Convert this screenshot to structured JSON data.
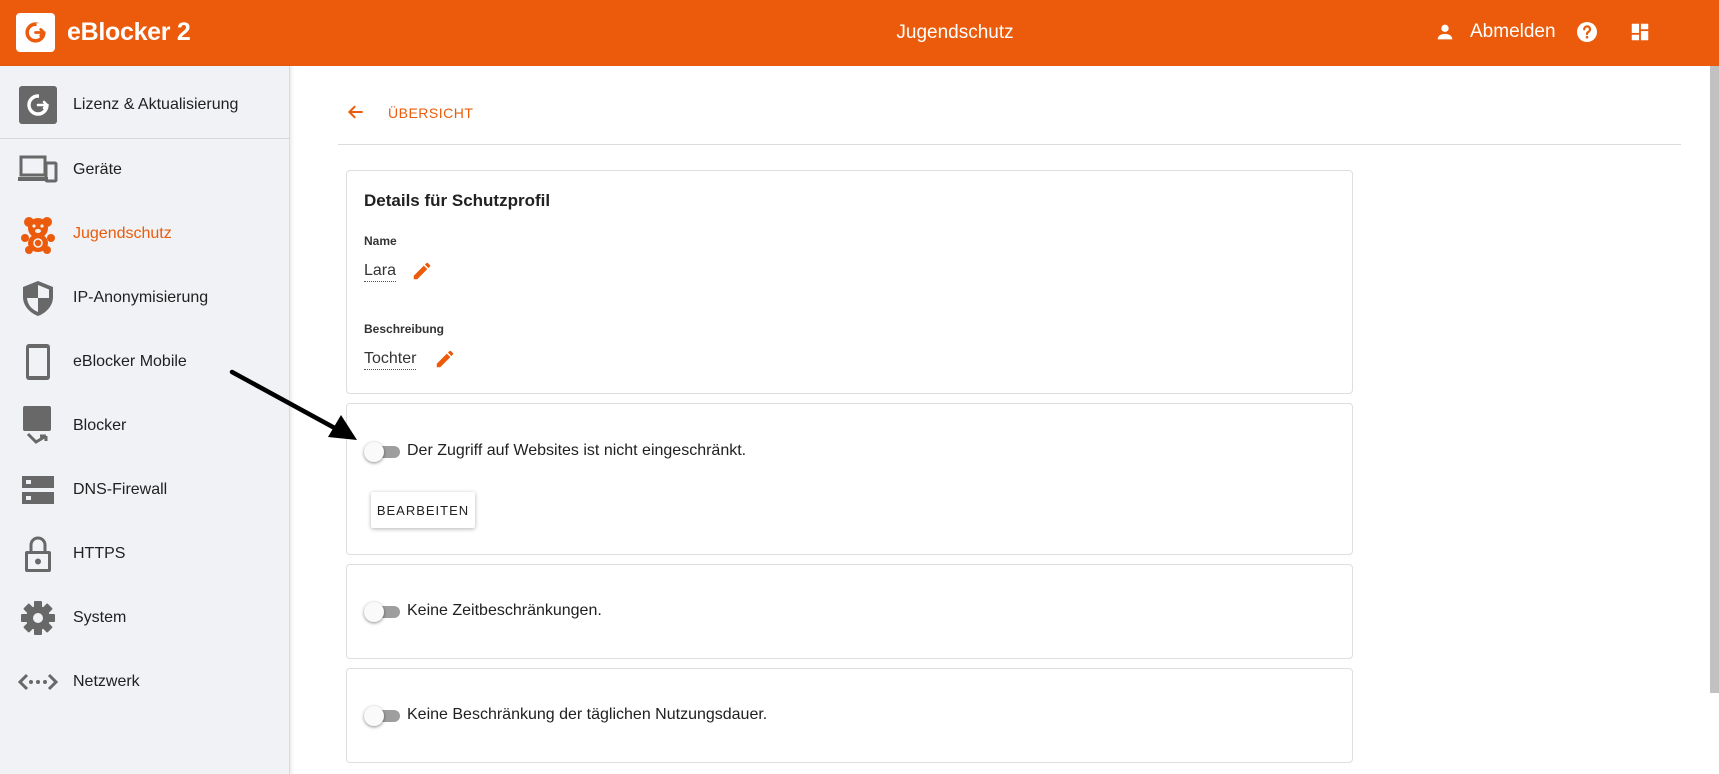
{
  "header": {
    "app_name": "eBlocker 2",
    "page_title": "Jugendschutz",
    "logout_label": "Abmelden",
    "accent_color": "#eb5b0b"
  },
  "sidebar": {
    "items": [
      {
        "label": "Lizenz & Aktualisierung",
        "icon": "license-update-icon"
      },
      {
        "label": "Geräte",
        "icon": "devices-icon"
      },
      {
        "label": "Jugendschutz",
        "icon": "teddy-bear-icon",
        "active": true
      },
      {
        "label": "IP-Anonymisierung",
        "icon": "shield-icon"
      },
      {
        "label": "eBlocker Mobile",
        "icon": "phone-icon"
      },
      {
        "label": "Blocker",
        "icon": "blocker-icon"
      },
      {
        "label": "DNS-Firewall",
        "icon": "dns-server-icon"
      },
      {
        "label": "HTTPS",
        "icon": "lock-icon"
      },
      {
        "label": "System",
        "icon": "gear-icon"
      },
      {
        "label": "Netzwerk",
        "icon": "network-icon"
      }
    ]
  },
  "main": {
    "back_label": "ÜBERSICHT",
    "details": {
      "title": "Details für Schutzprofil",
      "name_label": "Name",
      "name_value": "Lara",
      "description_label": "Beschreibung",
      "description_value": "Tochter"
    },
    "website_access": {
      "toggle_label": "Der Zugriff auf Websites ist nicht eingeschränkt.",
      "enabled": false,
      "edit_button": "BEARBEITEN"
    },
    "time_limits": {
      "toggle_label": "Keine Zeitbeschränkungen.",
      "enabled": false
    },
    "daily_usage": {
      "toggle_label": "Keine Beschränkung der täglichen Nutzungsdauer.",
      "enabled": false
    }
  }
}
